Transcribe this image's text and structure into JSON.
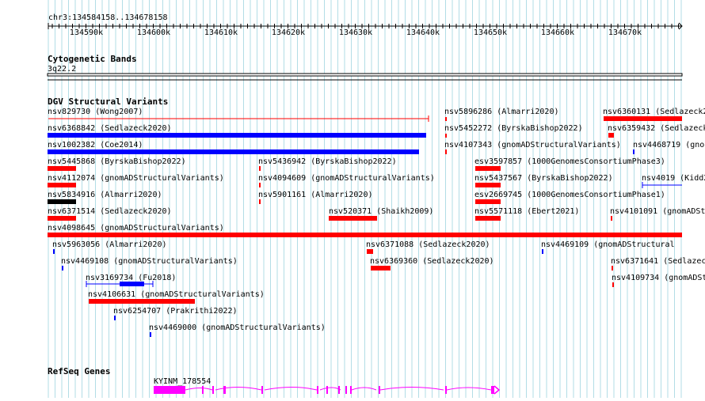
{
  "ruler": {
    "location": "chr3:134584158..134678158",
    "ticks": [
      "134590k",
      "134600k",
      "134610k",
      "134620k",
      "134630k",
      "134640k",
      "134650k",
      "134660k",
      "134670k"
    ]
  },
  "cytoband": {
    "title": "Cytogenetic Bands",
    "band": "3q22.2"
  },
  "dgv": {
    "title": "DGV Structural Variants",
    "features": [
      {
        "label": "nsv829730 (Wong2007)"
      },
      {
        "label": "nsv5896286 (Almarri2020)"
      },
      {
        "label": "nsv6360131 (Sedlazeck2"
      },
      {
        "label": "nsv6368842 (Sedlazeck2020)"
      },
      {
        "label": "nsv5452272 (ByrskaBishop2022)"
      },
      {
        "label": "nsv6359432 (Sedlazeck"
      },
      {
        "label": "nsv1002382 (Coe2014)"
      },
      {
        "label": "nsv4107343 (gnomADStructuralVariants)"
      },
      {
        "label": "nsv4468719 (gno"
      },
      {
        "label": "nsv5445868 (ByrskaBishop2022)"
      },
      {
        "label": "nsv5436942 (ByrskaBishop2022)"
      },
      {
        "label": "esv3597857 (1000GenomesConsortiumPhase3)"
      },
      {
        "label": "nsv4112074 (gnomADStructuralVariants)"
      },
      {
        "label": "nsv4094609 (gnomADStructuralVariants)"
      },
      {
        "label": "nsv5437567 (ByrskaBishop2022)"
      },
      {
        "label": "nsv4019 (Kidd2"
      },
      {
        "label": "nsv5834916 (Almarri2020)"
      },
      {
        "label": "nsv5901161 (Almarri2020)"
      },
      {
        "label": "esv2669745 (1000GenomesConsortiumPhase1)"
      },
      {
        "label": "nsv6371514 (Sedlazeck2020)"
      },
      {
        "label": "nsv520371 (Shaikh2009)"
      },
      {
        "label": "nsv5571118 (Ebert2021)"
      },
      {
        "label": "nsv4101091 (gnomADSt"
      },
      {
        "label": "nsv4098645 (gnomADStructuralVariants)"
      },
      {
        "label": "nsv5963056 (Almarri2020)"
      },
      {
        "label": "nsv6371088 (Sedlazeck2020)"
      },
      {
        "label": "nsv4469109 (gnomADStructural"
      },
      {
        "label": "nsv4469108 (gnomADStructuralVariants)"
      },
      {
        "label": "nsv6369360 (Sedlazeck2020)"
      },
      {
        "label": "nsv6371641 (Sedlazeck"
      },
      {
        "label": "nsv3169734 (Fu2018)"
      },
      {
        "label": "nsv4109734 (gnomADSt"
      },
      {
        "label": "nsv4106631 (gnomADStructuralVariants)"
      },
      {
        "label": "nsv6254707 (Prakrithi2022)"
      },
      {
        "label": "nsv4469000 (gnomADStructuralVariants)"
      }
    ]
  },
  "refseq": {
    "title": "RefSeq Genes",
    "gene_label": "KYINM_178554"
  },
  "colors": {
    "grid": "#b2dde6",
    "red": "#ff0000",
    "blue": "#0000ff",
    "black": "#000000",
    "gene": "#ff00ff"
  }
}
